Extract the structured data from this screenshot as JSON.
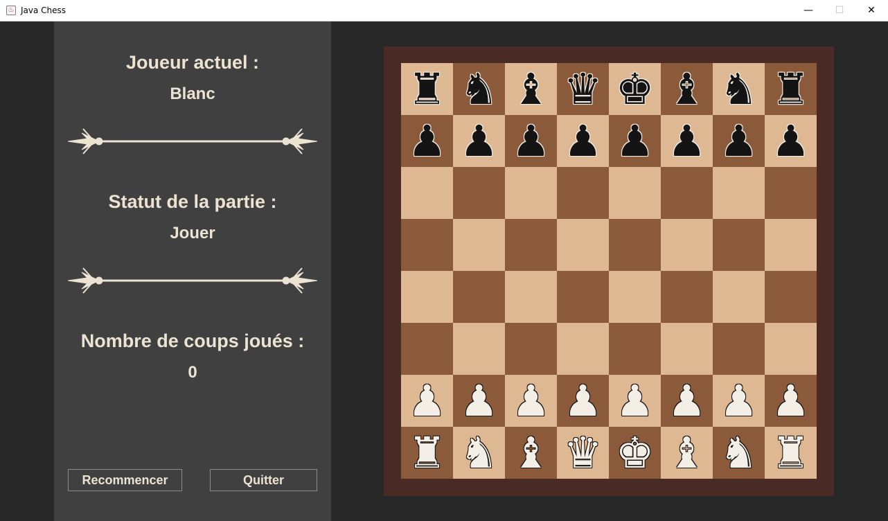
{
  "window": {
    "title": "Java Chess",
    "controls": {
      "minimize": "—",
      "maximize": "☐",
      "close": "✕"
    }
  },
  "info": {
    "current_player_label": "Joueur actuel :",
    "current_player_value": "Blanc",
    "status_label": "Statut de la partie :",
    "status_value": "Jouer",
    "moves_label": "Nombre de coups joués :",
    "moves_value": "0"
  },
  "buttons": {
    "restart": "Recommencer",
    "quit": "Quitter"
  },
  "colors": {
    "panel_bg": "#404040",
    "text": "#ece3d3",
    "board_frame": "#4a2a24",
    "light_square": "#deb893",
    "dark_square": "#8b5a3a"
  },
  "board": {
    "rows": [
      [
        "bR",
        "bN",
        "bB",
        "bQ",
        "bK",
        "bB",
        "bN",
        "bR"
      ],
      [
        "bP",
        "bP",
        "bP",
        "bP",
        "bP",
        "bP",
        "bP",
        "bP"
      ],
      [
        "",
        "",
        "",
        "",
        "",
        "",
        "",
        ""
      ],
      [
        "",
        "",
        "",
        "",
        "",
        "",
        "",
        ""
      ],
      [
        "",
        "",
        "",
        "",
        "",
        "",
        "",
        ""
      ],
      [
        "",
        "",
        "",
        "",
        "",
        "",
        "",
        ""
      ],
      [
        "wP",
        "wP",
        "wP",
        "wP",
        "wP",
        "wP",
        "wP",
        "wP"
      ],
      [
        "wR",
        "wN",
        "wB",
        "wQ",
        "wK",
        "wB",
        "wN",
        "wR"
      ]
    ],
    "top_left_square": "light"
  }
}
